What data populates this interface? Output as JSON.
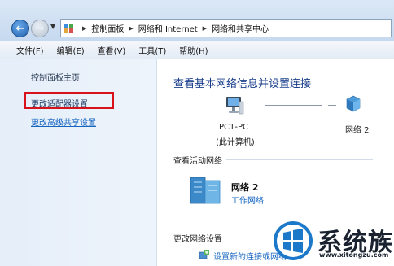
{
  "addressbar": {
    "breadcrumbs": [
      "控制面板",
      "网络和 Internet",
      "网络和共享中心"
    ]
  },
  "menubar": {
    "items": [
      "文件(F)",
      "编辑(E)",
      "查看(V)",
      "工具(T)",
      "帮助(H)"
    ]
  },
  "sidebar": {
    "home": "控制面板主页",
    "change_adapter": "更改适配器设置",
    "change_sharing": "更改高级共享设置"
  },
  "main": {
    "title": "查看基本网络信息并设置连接",
    "map": {
      "computer_name": "PC1-PC",
      "computer_sub": "(此计算机)",
      "network_name": "网络  2"
    },
    "active_section": "查看活动网络",
    "active_network": {
      "name": "网络  2",
      "type": "工作网络"
    },
    "change_section": "更改网络设置",
    "setup_link": "设置新的连接或网络"
  },
  "watermark": {
    "brand": "系统族",
    "url": "www.xitongzu.com"
  },
  "colors": {
    "link": "#1464c0",
    "title": "#1a3e8c",
    "highlight_box": "#d8121a",
    "sidebar_bg": "#e5eef9"
  }
}
